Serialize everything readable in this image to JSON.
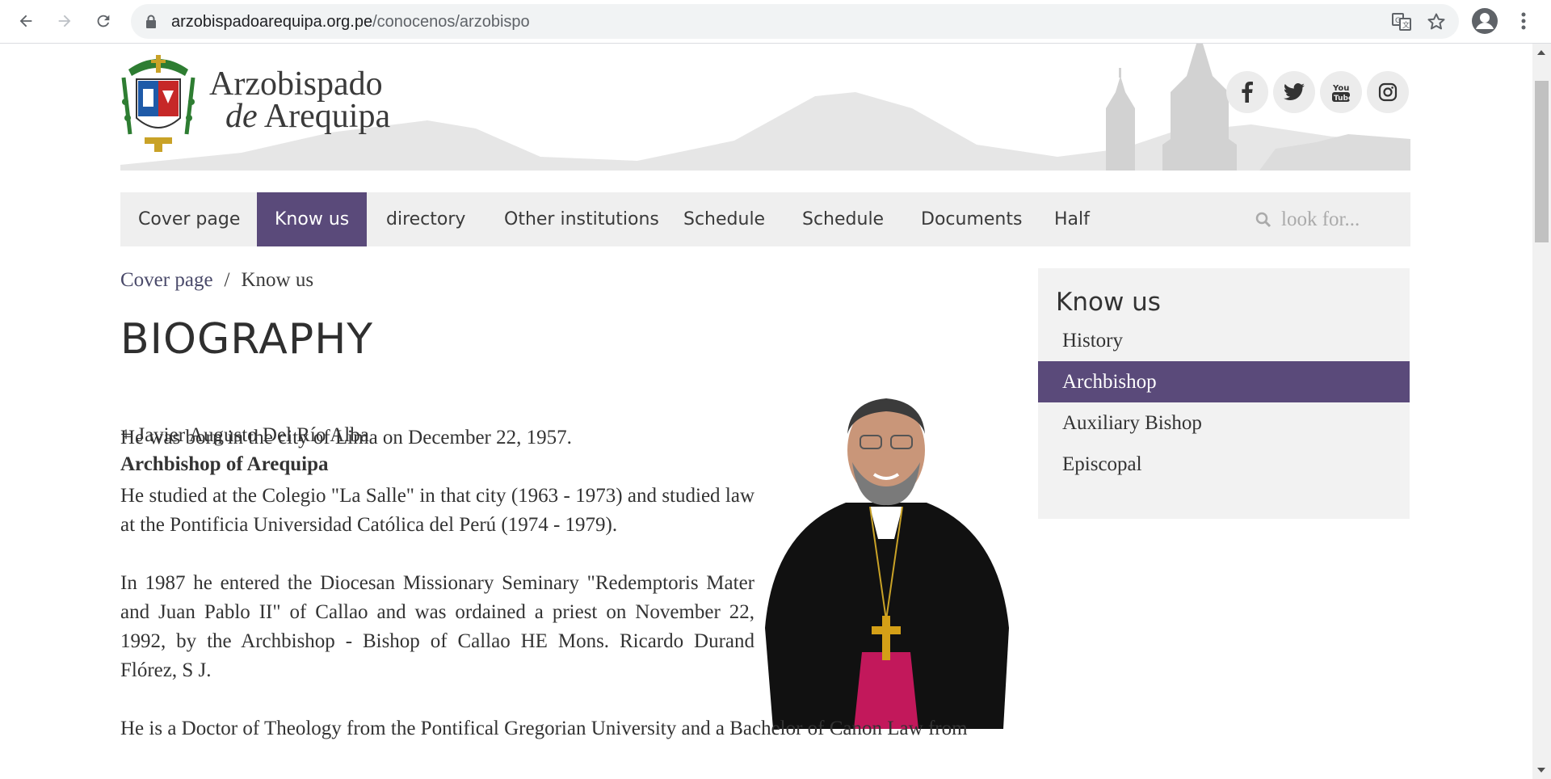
{
  "browser": {
    "url_domain": "arzobispadoarequipa.org.pe",
    "url_path": "/conocenos/arzobispo"
  },
  "site": {
    "logo_line1": "Arzobispado",
    "logo_line2_prefix": "de",
    "logo_line2_main": "Arequipa"
  },
  "social": [
    "facebook-icon",
    "twitter-icon",
    "youtube-icon",
    "instagram-icon"
  ],
  "nav": {
    "items": [
      {
        "label": "Cover page"
      },
      {
        "label": "Know us",
        "active": true
      },
      {
        "label": "directory"
      },
      {
        "label": "Other institutions"
      },
      {
        "label": "Schedule"
      },
      {
        "label": "Schedule"
      },
      {
        "label": "Documents"
      },
      {
        "label": "Half"
      }
    ],
    "search_placeholder": "look for..."
  },
  "breadcrumb": {
    "home": "Cover page",
    "separator": "/",
    "current": "Know us"
  },
  "page": {
    "title": "BIOGRAPHY",
    "name": "+ Javier Augusto Del Río Alba",
    "role": "Archbishop of Arequipa",
    "paragraphs": [
      "He was born in the city of Lima on December 22, 1957.",
      "He studied at the Colegio \"La Salle\" in that city (1963 - 1973) and studied law at the Pontificia Universidad Católica del Perú (1974 - 1979).",
      "In 1987 he entered the Diocesan Missionary Seminary \"Redemptoris Mater and Juan Pablo II\" of Callao and was ordained a priest on November 22, 1992, by the Archbishop - Bishop of Callao HE Mons. Ricardo Durand Flórez, S J.",
      "He is a Doctor of Theology from the Pontifical Gregorian University and a Bachelor of Canon Law from"
    ]
  },
  "sidebar": {
    "title": "Know us",
    "items": [
      {
        "label": "History"
      },
      {
        "label": "Archbishop",
        "active": true
      },
      {
        "label": "Auxiliary Bishop"
      },
      {
        "label": "Episcopal"
      }
    ]
  },
  "colors": {
    "accent": "#5a4a7a",
    "nav_bg": "#efefef",
    "sidebar_bg": "#f2f2f2"
  }
}
